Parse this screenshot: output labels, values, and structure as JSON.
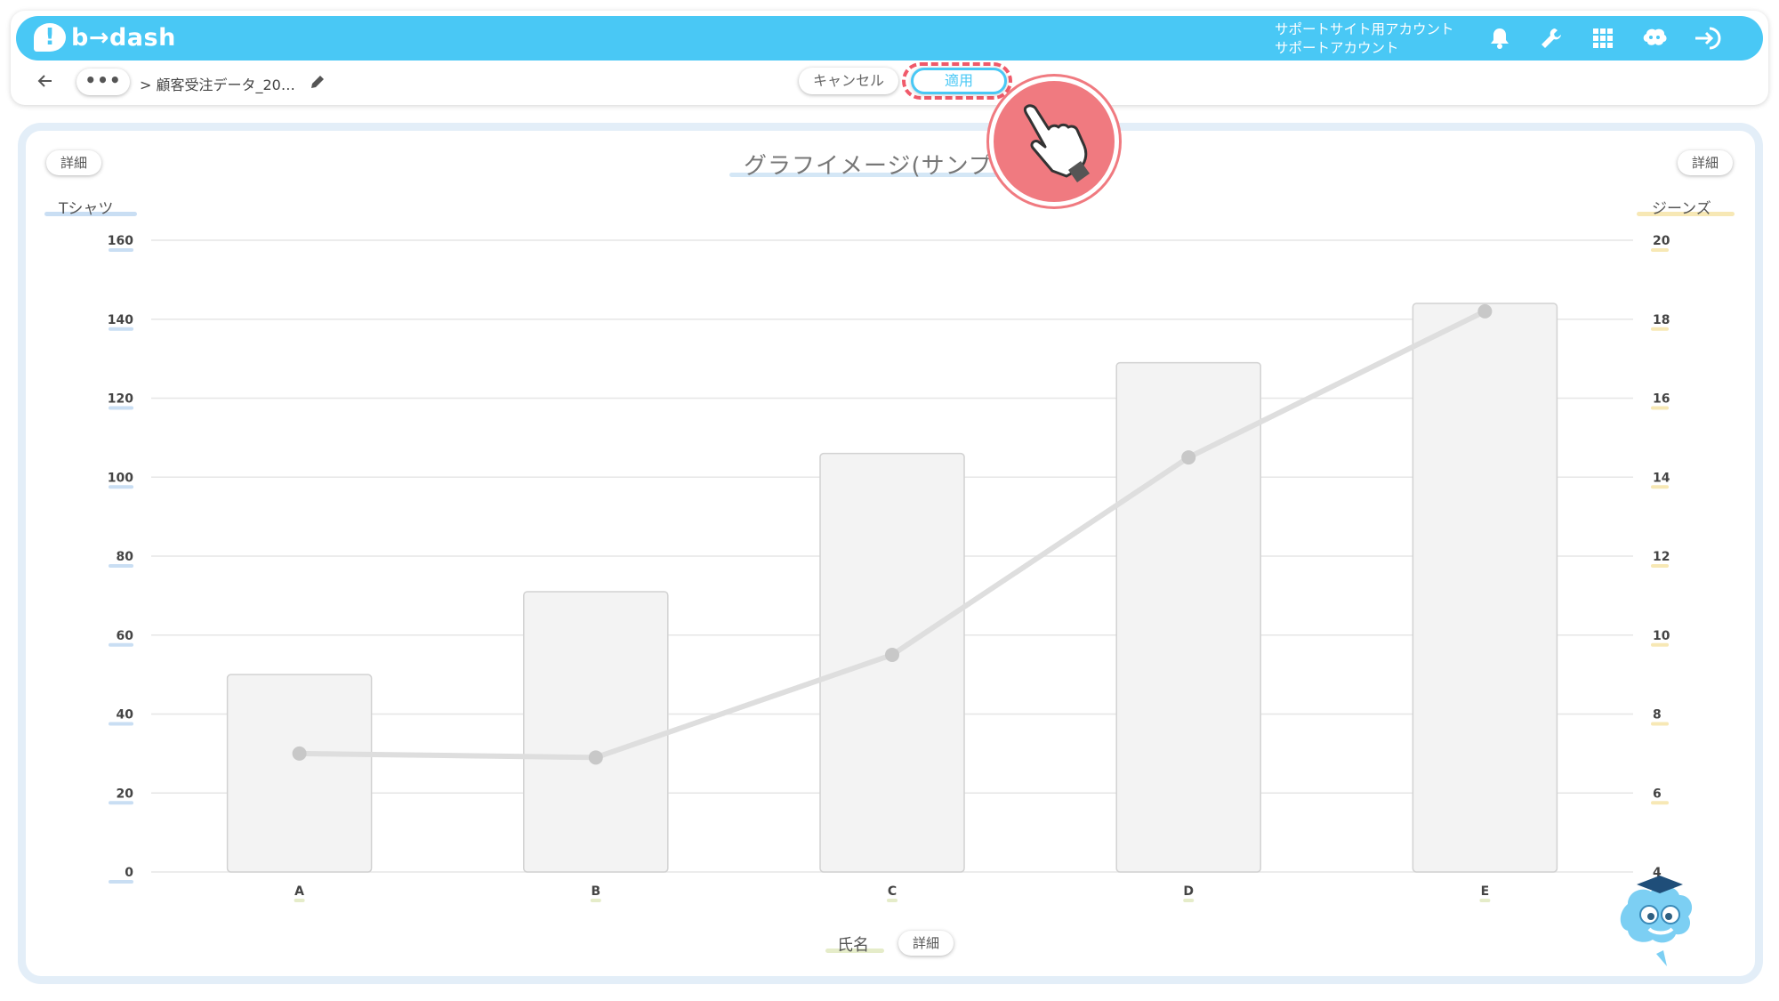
{
  "brand": {
    "name": "b→dash",
    "accent": "#49c8f5",
    "highlight": "#f05a6a"
  },
  "account": {
    "line1": "サポートサイト用アカウント",
    "line2": "サポートアカウント"
  },
  "top_icons": [
    "bell-icon",
    "wrench-icon",
    "grid-icon",
    "brain-icon",
    "logout-icon"
  ],
  "toolbar": {
    "more_label": "•••",
    "breadcrumb": "> 顧客受注データ_20…",
    "cancel_label": "キャンセル",
    "apply_label": "適用"
  },
  "chart_panel": {
    "title": "グラフイメージ(サンプ",
    "detail_label": "詳細"
  },
  "chart_data": {
    "type": "bar",
    "categories": [
      "A",
      "B",
      "C",
      "D",
      "E"
    ],
    "xlabel": "氏名",
    "series": [
      {
        "name": "Tシャツ",
        "type": "bar",
        "axis": "left",
        "values": [
          50,
          71,
          106,
          129,
          144
        ]
      },
      {
        "name": "ジーンズ",
        "type": "line",
        "axis": "right",
        "values": [
          7.0,
          6.9,
          9.5,
          14.5,
          18.2
        ]
      }
    ],
    "y_left": {
      "label": "Tシャツ",
      "ylim": [
        0,
        160
      ],
      "ticks": [
        0,
        20,
        40,
        60,
        80,
        100,
        120,
        140,
        160
      ]
    },
    "y_right": {
      "label": "ジーンズ",
      "ylim": [
        4,
        20
      ],
      "ticks": [
        4,
        6,
        8,
        10,
        12,
        14,
        16,
        18,
        20
      ]
    },
    "grid": true,
    "bar_fill": "#f3f3f3",
    "bar_stroke": "#d2d2d2",
    "line_color": "#dedede",
    "point_color": "#c8c8c8",
    "left_tick_mark_color": "#c9def3",
    "right_tick_mark_color": "#f7e8b5",
    "x_tick_mark_color": "#e5ecc9"
  }
}
